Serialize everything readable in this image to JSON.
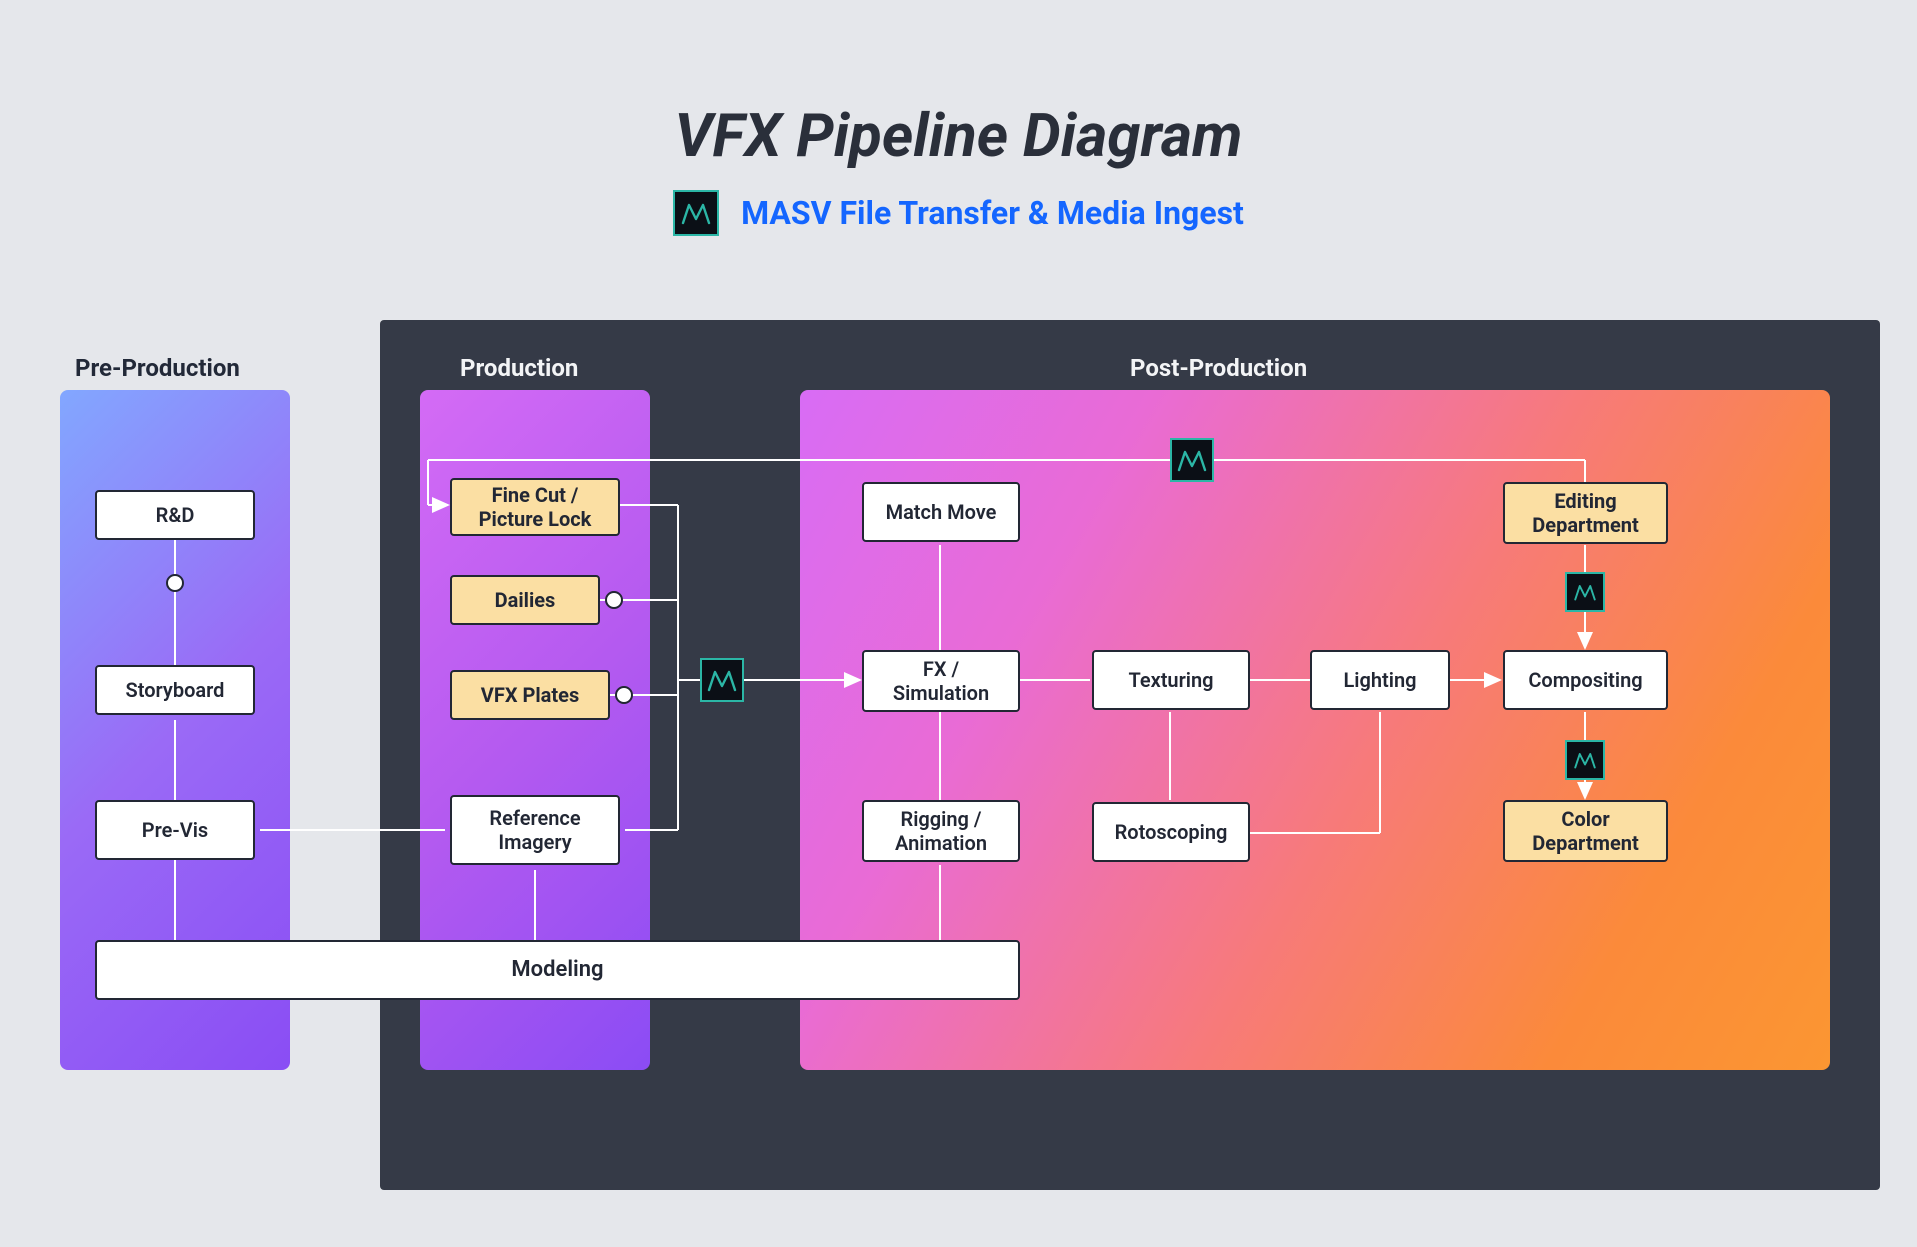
{
  "title": "VFX Pipeline Diagram",
  "subtitle": "MASV File Transfer & Media Ingest",
  "sections": {
    "preprod": "Pre-Production",
    "prod": "Production",
    "postprod": "Post-Production"
  },
  "nodes": {
    "rd": "R&D",
    "storyboard": "Storyboard",
    "previs": "Pre-Vis",
    "finecut": "Fine Cut / Picture Lock",
    "dailies": "Dailies",
    "vfxplates": "VFX Plates",
    "refimg": "Reference Imagery",
    "modeling": "Modeling",
    "matchmove": "Match Move",
    "fxsim": "FX / Simulation",
    "rigging": "Rigging / Animation",
    "texturing": "Texturing",
    "rotoscoping": "Rotoscoping",
    "lighting": "Lighting",
    "editing": "Editing Department",
    "compositing": "Compositing",
    "color": "Color Department"
  },
  "icon_name": "masv-logo-icon"
}
